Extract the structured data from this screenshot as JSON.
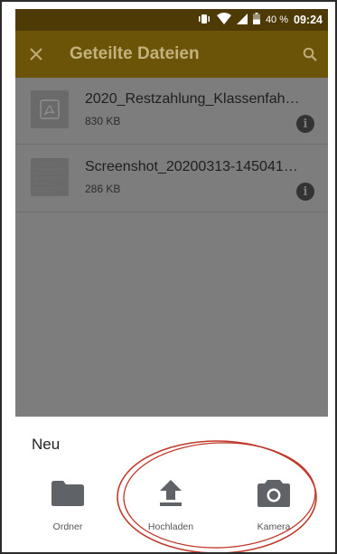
{
  "status_bar": {
    "battery_percent": "40 %",
    "time": "09:24"
  },
  "app_bar": {
    "title": "Geteilte Dateien",
    "close_icon": "close-icon",
    "search_icon": "search-icon"
  },
  "files": [
    {
      "name": "2020_Restzahlung_Klassenfah…",
      "size": "830 KB",
      "type": "pdf"
    },
    {
      "name": "Screenshot_20200313-145041…",
      "size": "286 KB",
      "type": "image"
    }
  ],
  "sheet": {
    "title": "Neu",
    "actions": [
      {
        "label": "Ordner",
        "icon": "folder-icon"
      },
      {
        "label": "Hochladen",
        "icon": "upload-icon"
      },
      {
        "label": "Kamera",
        "icon": "camera-icon"
      }
    ]
  },
  "colors": {
    "status_bar": "#4e3a05",
    "app_bar": "#6b5307",
    "dim_overlay": "#7d7d7d",
    "annotation": "#c0392b"
  }
}
